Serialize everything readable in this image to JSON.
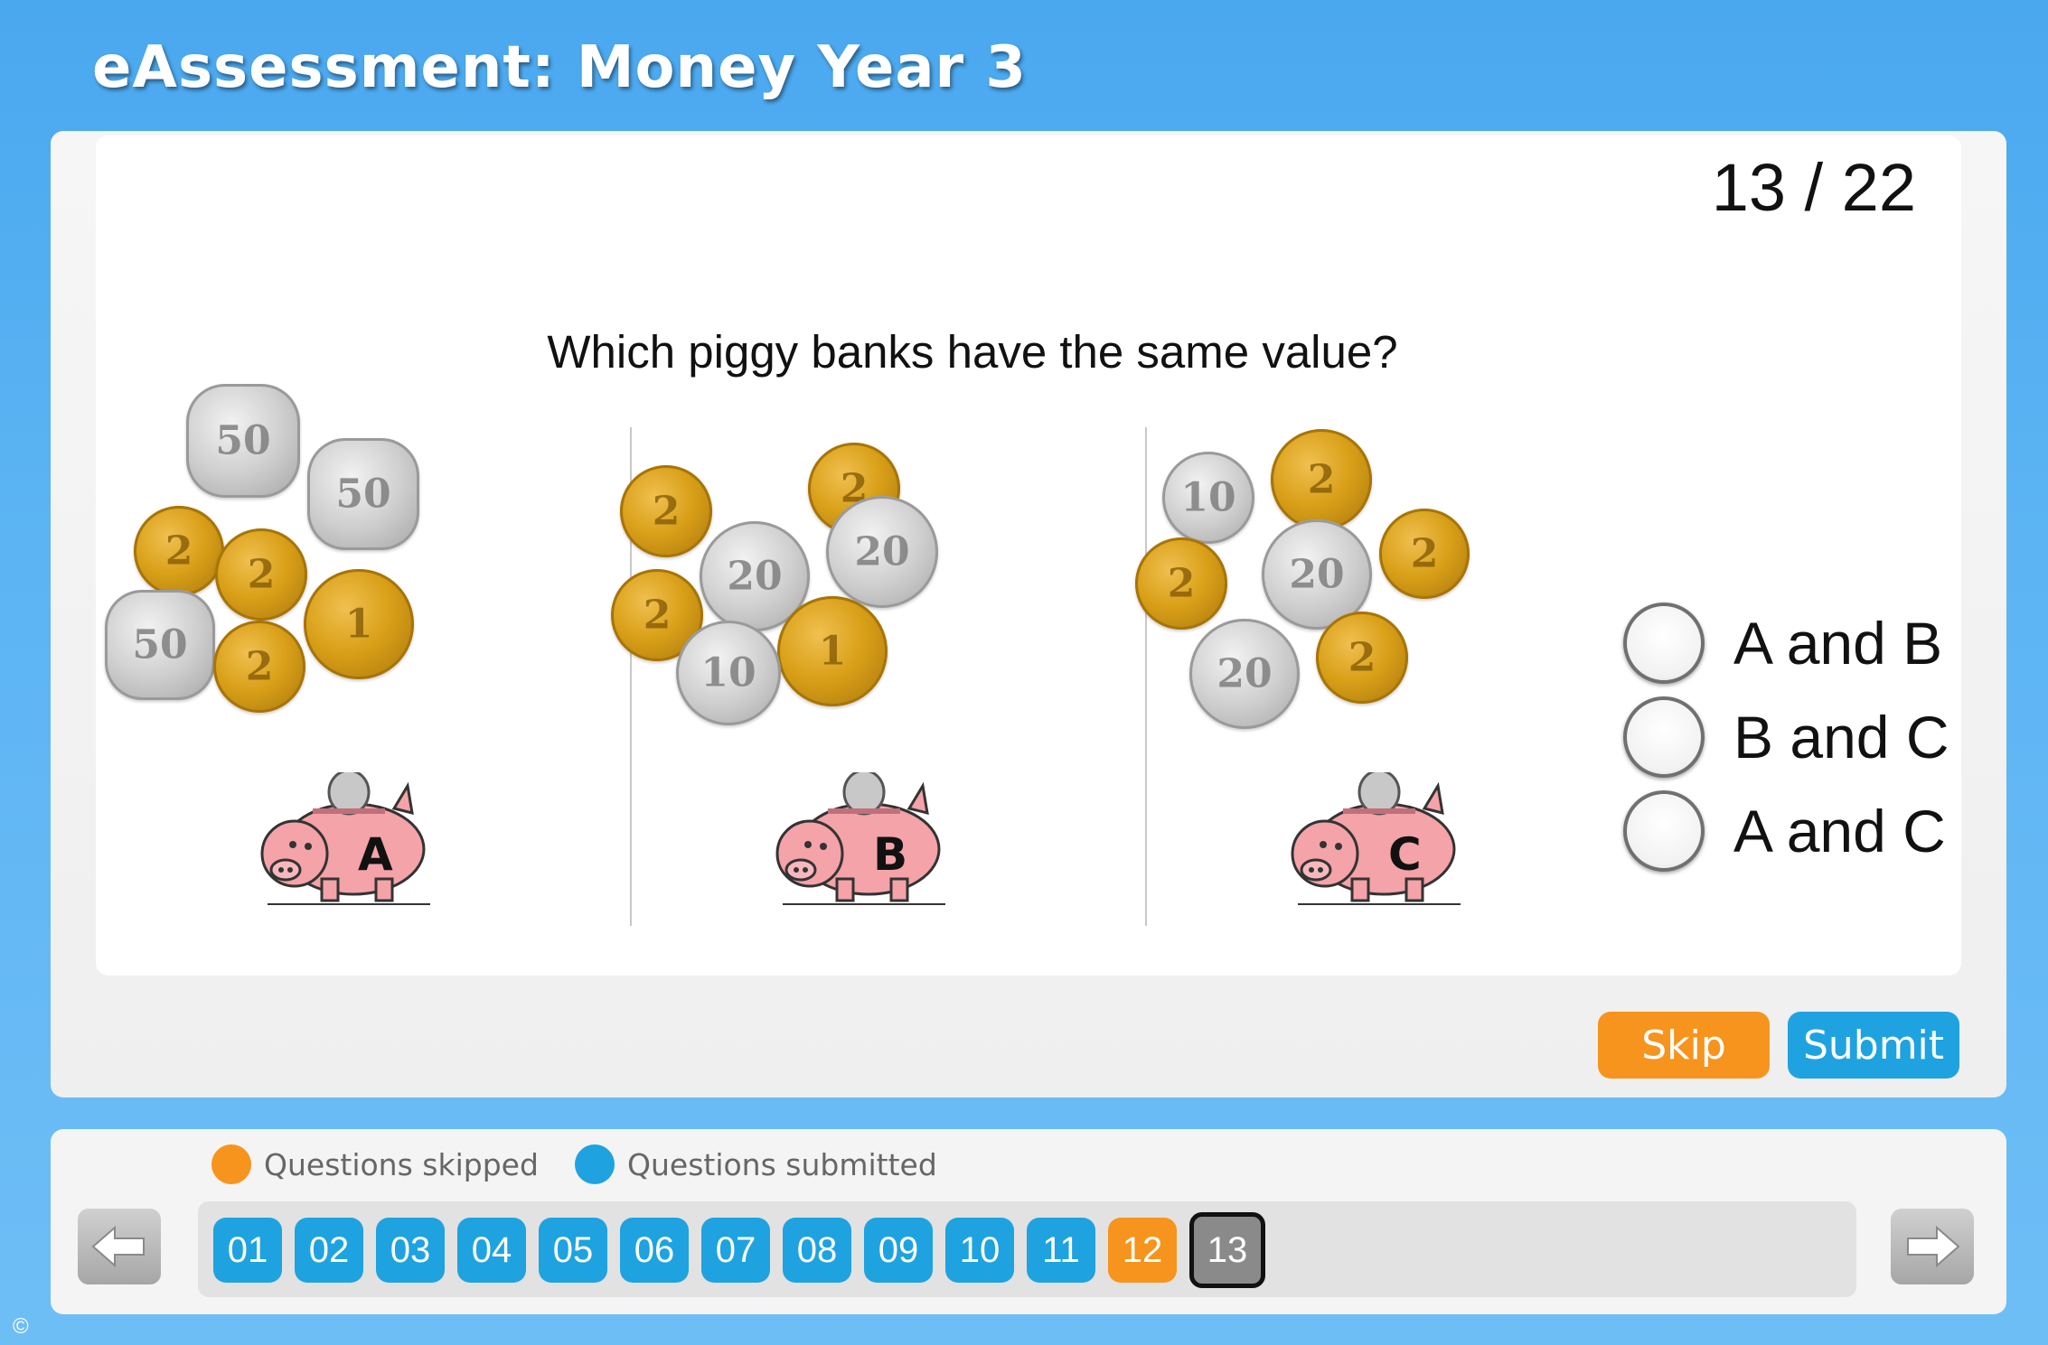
{
  "header": {
    "title": "eAssessment: Money Year 3"
  },
  "question": {
    "counter": "13 / 22",
    "text": "Which piggy banks have the same value?",
    "banks": [
      {
        "label": "A",
        "coins": [
          {
            "type": "silver",
            "shape": "poly",
            "value": "50"
          },
          {
            "type": "silver",
            "shape": "poly",
            "value": "50"
          },
          {
            "type": "gold",
            "value": "2"
          },
          {
            "type": "gold",
            "value": "2"
          },
          {
            "type": "gold",
            "value": "1"
          },
          {
            "type": "silver",
            "shape": "poly",
            "value": "50"
          },
          {
            "type": "gold",
            "value": "2"
          }
        ]
      },
      {
        "label": "B",
        "coins": [
          {
            "type": "gold",
            "value": "2"
          },
          {
            "type": "gold",
            "value": "2"
          },
          {
            "type": "silver",
            "value": "20"
          },
          {
            "type": "silver",
            "value": "20"
          },
          {
            "type": "gold",
            "value": "2"
          },
          {
            "type": "gold",
            "value": "1"
          },
          {
            "type": "silver",
            "value": "10"
          }
        ]
      },
      {
        "label": "C",
        "coins": [
          {
            "type": "gold",
            "value": "2"
          },
          {
            "type": "silver",
            "value": "10"
          },
          {
            "type": "silver",
            "value": "20"
          },
          {
            "type": "gold",
            "value": "2"
          },
          {
            "type": "gold",
            "value": "2"
          },
          {
            "type": "silver",
            "value": "20"
          },
          {
            "type": "gold",
            "value": "2"
          }
        ]
      }
    ],
    "options": [
      "A and B",
      "B and C",
      "A and C"
    ]
  },
  "actions": {
    "skip_label": "Skip",
    "submit_label": "Submit"
  },
  "navigator": {
    "legend_skipped": "Questions skipped",
    "legend_submitted": "Questions submitted",
    "questions": [
      {
        "label": "01",
        "status": "submitted"
      },
      {
        "label": "02",
        "status": "submitted"
      },
      {
        "label": "03",
        "status": "submitted"
      },
      {
        "label": "04",
        "status": "submitted"
      },
      {
        "label": "05",
        "status": "submitted"
      },
      {
        "label": "06",
        "status": "submitted"
      },
      {
        "label": "07",
        "status": "submitted"
      },
      {
        "label": "08",
        "status": "submitted"
      },
      {
        "label": "09",
        "status": "submitted"
      },
      {
        "label": "10",
        "status": "submitted"
      },
      {
        "label": "11",
        "status": "submitted"
      },
      {
        "label": "12",
        "status": "skipped"
      },
      {
        "label": "13",
        "status": "current"
      }
    ],
    "prev_icon": "left-arrow-icon",
    "next_icon": "right-arrow-icon"
  },
  "colors": {
    "skipped": "#f7941d",
    "submitted": "#1ea3e0",
    "current": "#8a8a8a"
  },
  "footer": {
    "copyright": "©"
  }
}
